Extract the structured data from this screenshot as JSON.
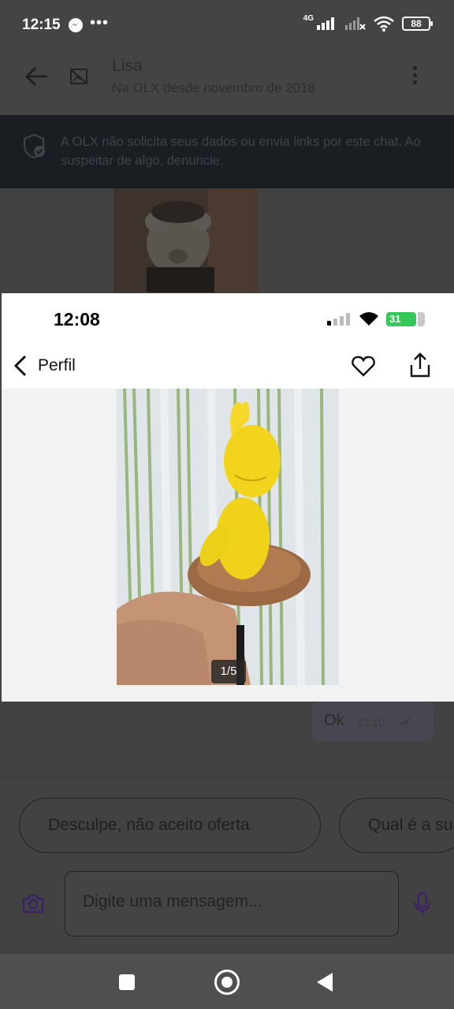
{
  "status_bar": {
    "time": "12:15",
    "more": "•••",
    "network": "4G",
    "battery": "88",
    "icons": [
      "messenger-icon",
      "signal-icon",
      "wifi-icon",
      "battery-icon"
    ]
  },
  "chat_header": {
    "name": "Lisa",
    "member_since": "Na OLX desde novembro de 2018",
    "icons": [
      "back-arrow-icon",
      "avatar-placeholder-icon",
      "more-vert-icon"
    ]
  },
  "security_banner": {
    "text": "A OLX não solicita seus dados ou envia links por este chat. Ao suspeitar de algo, denuncie."
  },
  "sent_message": {
    "text": "Ok",
    "time": "12:10"
  },
  "quick_replies": [
    "Desculpe, não aceito oferta",
    "Qual é a sua"
  ],
  "composer": {
    "placeholder": "Digite uma mensagem..."
  },
  "ios_screenshot": {
    "time": "12:08",
    "battery": "31",
    "battery_color": "#34c759",
    "back_label": "Perfil",
    "photo_counter": "1/5",
    "icons": [
      "chevron-left-icon",
      "heart-icon",
      "share-icon"
    ]
  },
  "colors": {
    "overlay_dark": "#424242",
    "banner_dark": "#1a1d22",
    "accent_purple": "#6e0ad6"
  }
}
